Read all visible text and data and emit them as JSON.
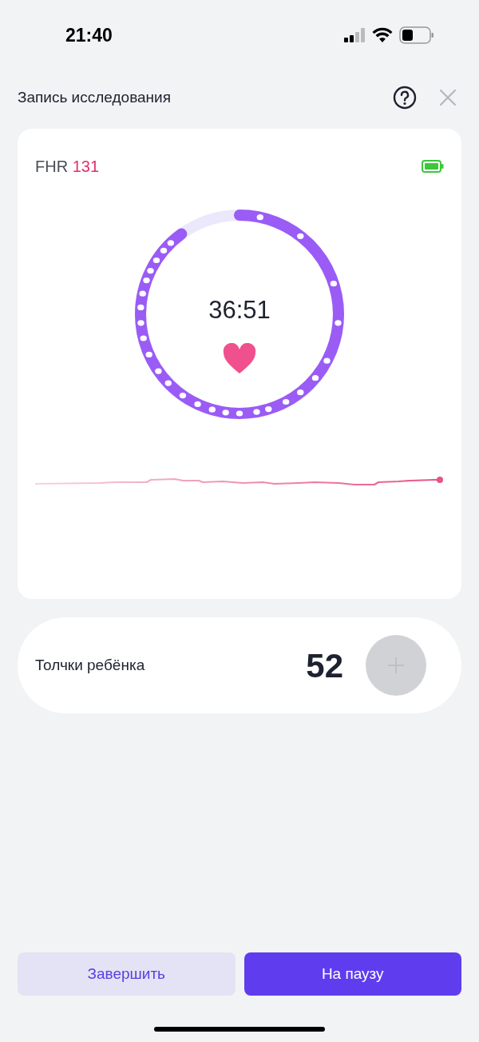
{
  "status_bar": {
    "time": "21:40"
  },
  "header": {
    "title": "Запись исследования"
  },
  "monitor": {
    "fhr_label": "FHR",
    "fhr_value": "131",
    "timer": "36:51",
    "progress": {
      "level": 0.9
    }
  },
  "kicks": {
    "label": "Толчки ребёнка",
    "count": "52",
    "add_disabled": true
  },
  "buttons": [
    {
      "label": "Завершить",
      "kind": "secondary"
    },
    {
      "label": "На паузу",
      "kind": "primary"
    }
  ]
}
